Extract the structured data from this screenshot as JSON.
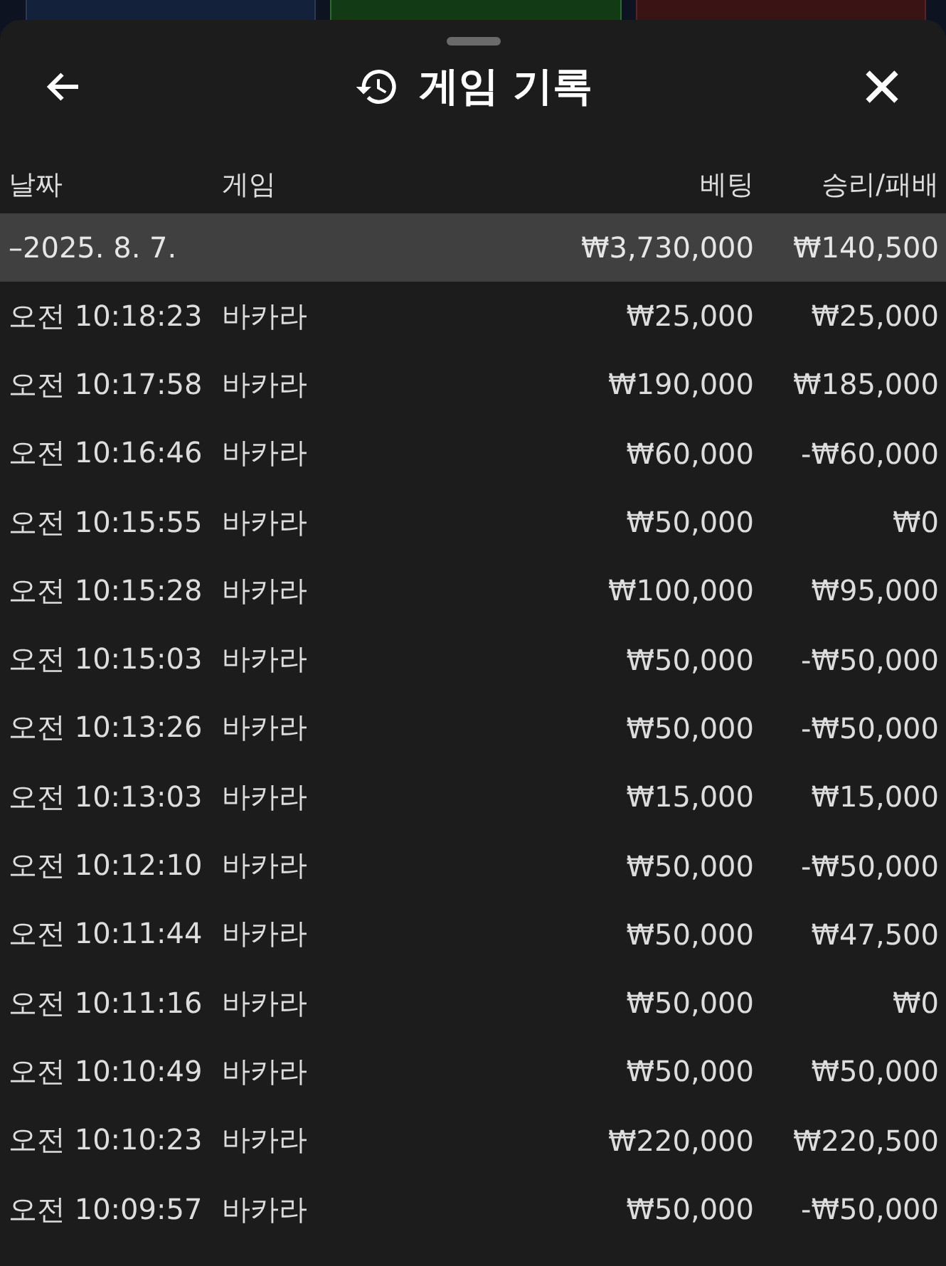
{
  "header": {
    "title": "게임 기록"
  },
  "table": {
    "columns": [
      "날짜",
      "게임",
      "베팅",
      "승리/패배"
    ],
    "group": {
      "date": "–2025. 8. 7.",
      "bet": "₩3,730,000",
      "result": "₩140,500",
      "expanded": true
    },
    "rows": [
      {
        "time": "오전 10:18:23",
        "game": "바카라",
        "bet": "₩25,000",
        "result": "₩25,000"
      },
      {
        "time": "오전 10:17:58",
        "game": "바카라",
        "bet": "₩190,000",
        "result": "₩185,000"
      },
      {
        "time": "오전 10:16:46",
        "game": "바카라",
        "bet": "₩60,000",
        "result": "-₩60,000"
      },
      {
        "time": "오전 10:15:55",
        "game": "바카라",
        "bet": "₩50,000",
        "result": "₩0"
      },
      {
        "time": "오전 10:15:28",
        "game": "바카라",
        "bet": "₩100,000",
        "result": "₩95,000"
      },
      {
        "time": "오전 10:15:03",
        "game": "바카라",
        "bet": "₩50,000",
        "result": "-₩50,000"
      },
      {
        "time": "오전 10:13:26",
        "game": "바카라",
        "bet": "₩50,000",
        "result": "-₩50,000"
      },
      {
        "time": "오전 10:13:03",
        "game": "바카라",
        "bet": "₩15,000",
        "result": "₩15,000"
      },
      {
        "time": "오전 10:12:10",
        "game": "바카라",
        "bet": "₩50,000",
        "result": "-₩50,000"
      },
      {
        "time": "오전 10:11:44",
        "game": "바카라",
        "bet": "₩50,000",
        "result": "₩47,500"
      },
      {
        "time": "오전 10:11:16",
        "game": "바카라",
        "bet": "₩50,000",
        "result": "₩0"
      },
      {
        "time": "오전 10:10:49",
        "game": "바카라",
        "bet": "₩50,000",
        "result": "₩50,000"
      },
      {
        "time": "오전 10:10:23",
        "game": "바카라",
        "bet": "₩220,000",
        "result": "₩220,500"
      },
      {
        "time": "오전 10:09:57",
        "game": "바카라",
        "bet": "₩50,000",
        "result": "-₩50,000"
      }
    ]
  }
}
